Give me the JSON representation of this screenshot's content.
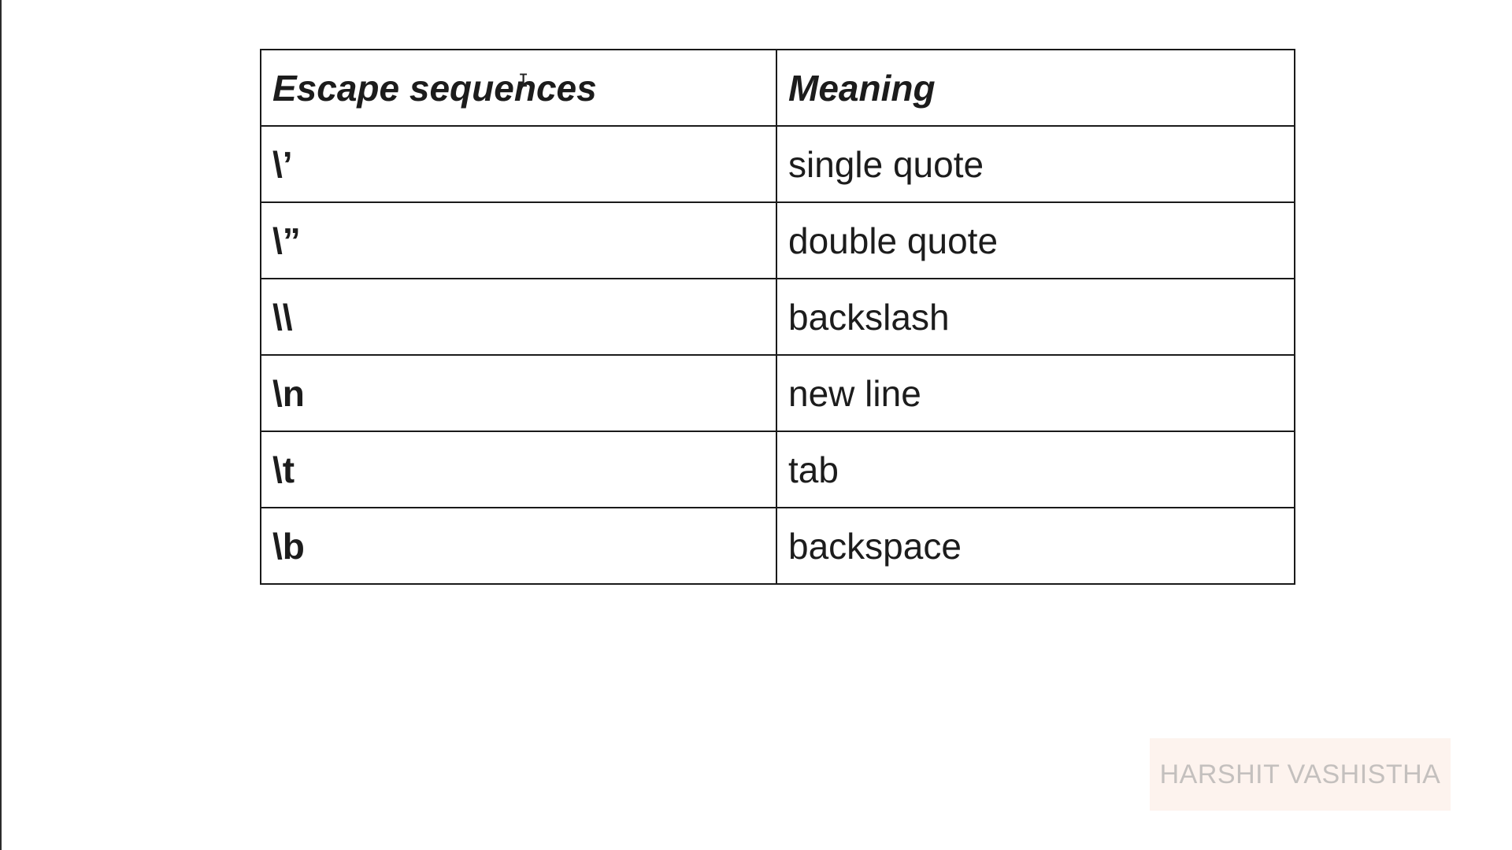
{
  "table": {
    "headers": [
      "Escape sequences",
      "Meaning"
    ],
    "rows": [
      {
        "sequence": "\\’",
        "meaning": "single quote"
      },
      {
        "sequence": "\\”",
        "meaning": "double quote"
      },
      {
        "sequence": "\\\\",
        "meaning": "backslash"
      },
      {
        "sequence": "\\n",
        "meaning": "new line"
      },
      {
        "sequence": "\\t",
        "meaning": "tab"
      },
      {
        "sequence": "\\b",
        "meaning": "backspace"
      }
    ]
  },
  "watermark": {
    "text": "HARSHIT VASHISTHA"
  },
  "icons": {
    "cursor": "text-cursor-icon"
  }
}
